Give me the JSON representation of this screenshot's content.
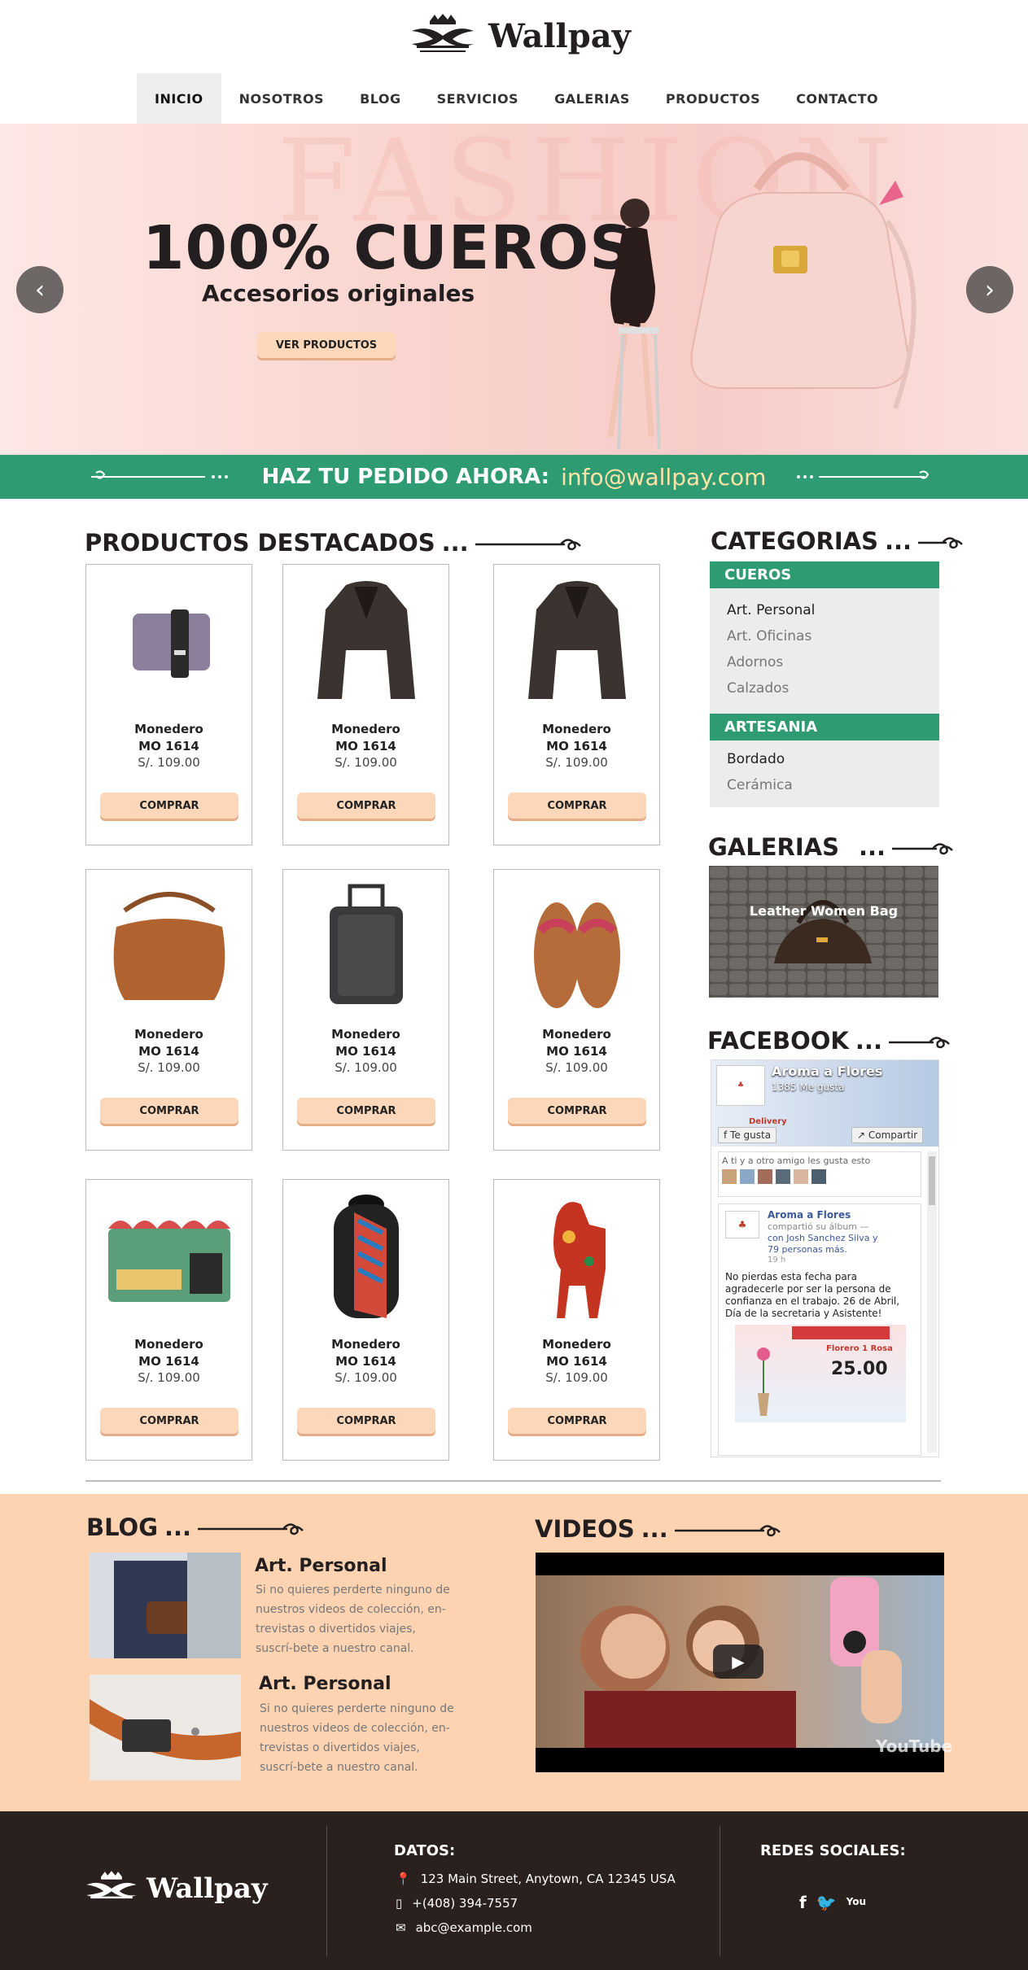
{
  "header": {
    "brand": "Wallpay",
    "nav": [
      {
        "label": "INICIO",
        "active": true
      },
      {
        "label": "NOSOTROS",
        "active": false
      },
      {
        "label": "BLOG",
        "active": false
      },
      {
        "label": "SERVICIOS",
        "active": false
      },
      {
        "label": "GALERIAS",
        "active": false
      },
      {
        "label": "PRODUCTOS",
        "active": false
      },
      {
        "label": "CONTACTO",
        "active": false
      }
    ]
  },
  "hero": {
    "background_word": "FASHION",
    "title": "100% CUEROS",
    "subtitle": "Accesorios originales",
    "button": "VER PRODUCTOS",
    "prev_icon": "chevron-left-icon",
    "next_icon": "chevron-right-icon"
  },
  "banner": {
    "text": "HAZ TU PEDIDO AHORA:",
    "email": "info@wallpay.com"
  },
  "products": {
    "title": "PRODUCTOS DESTACADOS",
    "ellipsis": "...",
    "items": [
      {
        "name1": "Monedero",
        "name2": "MO 1614",
        "price": "S/. 109.00",
        "button": "COMPRAR",
        "icon": "wallet-icon"
      },
      {
        "name1": "Monedero",
        "name2": "MO 1614",
        "price": "S/. 109.00",
        "button": "COMPRAR",
        "icon": "jacket-icon"
      },
      {
        "name1": "Monedero",
        "name2": "MO 1614",
        "price": "S/. 109.00",
        "button": "COMPRAR",
        "icon": "jacket-icon"
      },
      {
        "name1": "Monedero",
        "name2": "MO 1614",
        "price": "S/. 109.00",
        "button": "COMPRAR",
        "icon": "handbag-icon"
      },
      {
        "name1": "Monedero",
        "name2": "MO 1614",
        "price": "S/. 109.00",
        "button": "COMPRAR",
        "icon": "suitcase-icon"
      },
      {
        "name1": "Monedero",
        "name2": "MO 1614",
        "price": "S/. 109.00",
        "button": "COMPRAR",
        "icon": "sandals-icon"
      },
      {
        "name1": "Monedero",
        "name2": "MO 1614",
        "price": "S/. 109.00",
        "button": "COMPRAR",
        "icon": "wallet-icon"
      },
      {
        "name1": "Monedero",
        "name2": "MO 1614",
        "price": "S/. 109.00",
        "button": "COMPRAR",
        "icon": "backpack-icon"
      },
      {
        "name1": "Monedero",
        "name2": "MO 1614",
        "price": "S/. 109.00",
        "button": "COMPRAR",
        "icon": "horse-figurine-icon"
      }
    ]
  },
  "categories": {
    "title": "CATEGORIAS",
    "ellipsis": "...",
    "groups": [
      {
        "name": "CUEROS",
        "items": [
          "Art. Personal",
          "Art. Oficinas",
          "Adornos",
          "Calzados"
        ]
      },
      {
        "name": "ARTESANIA",
        "items": [
          "Bordado",
          "Cerámica"
        ]
      }
    ]
  },
  "galerias": {
    "title": "GALERIAS",
    "ellipsis": "...",
    "image_caption": "Leather Women Bag"
  },
  "facebook": {
    "title": "FACEBOOK",
    "ellipsis": "...",
    "page_name": "Aroma a Flores",
    "likes": "1385 Me gusta",
    "like_btn": "Te gusta",
    "share_btn": "Compartir",
    "delivery": "Delivery",
    "friends_text": "A ti y a otro amigo les gusta esto",
    "post_author": "Aroma a Flores",
    "post_line1": "compartió su álbum —",
    "post_line2": "con Josh Sanchez Silva y",
    "post_line3": "79 personas más.",
    "post_time": "19 h",
    "post_text": "No pierdas esta fecha para agradecerle por ser la persona de confianza en el trabajo. 26 de Abril, Día de la secretaria y Asistente!",
    "promo_name": "Florero 1 Rosa",
    "promo_price": "25.00"
  },
  "blog": {
    "title": "BLOG",
    "ellipsis": "...",
    "posts": [
      {
        "title": "Art. Personal",
        "text": "Si no quieres perderte ninguno de nuestros videos de colección, en-trevistas o divertidos viajes, suscrí-bete a nuestro canal."
      },
      {
        "title": "Art. Personal",
        "text": "Si no quieres perderte ninguno de nuestros videos de colección, en-trevistas o divertidos viajes, suscrí-bete a nuestro canal."
      }
    ]
  },
  "videos": {
    "title": "VIDEOS",
    "ellipsis": "...",
    "watermark": "YouTube"
  },
  "footer": {
    "brand": "Wallpay",
    "datos_title": "DATOS:",
    "address": "123 Main Street, Anytown, CA 12345 USA",
    "phone": "+(408) 394-7557",
    "email": "abc@example.com",
    "social_title": "REDES SOCIALES:",
    "social": [
      "facebook-icon",
      "twitter-icon",
      "youtube-icon"
    ]
  }
}
